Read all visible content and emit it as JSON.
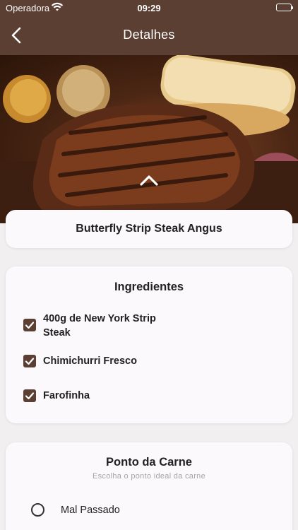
{
  "status_bar": {
    "carrier": "Operadora",
    "time": "09:29"
  },
  "nav": {
    "title": "Detalhes",
    "back_icon": "chevron-left-icon"
  },
  "hero": {
    "image_alt": "steak-photo",
    "expand_icon": "chevron-up-icon"
  },
  "dish": {
    "name": "Butterfly Strip Steak Angus"
  },
  "ingredients": {
    "heading": "Ingredientes",
    "items": [
      {
        "label_line1": "400g de New York Strip",
        "label_line2": "Steak",
        "checked": true
      },
      {
        "label_line1": "Chimichurri Fresco",
        "label_line2": "",
        "checked": true
      },
      {
        "label_line1": "Farofinha",
        "label_line2": "",
        "checked": true
      }
    ]
  },
  "doneness": {
    "heading": "Ponto da Carne",
    "subtitle": "Escolha o ponto ideal da carne",
    "options": [
      {
        "label": "Mal Passado",
        "selected": false
      }
    ]
  },
  "colors": {
    "brand": "#5c3f33",
    "background": "#efecec",
    "card": "#fbf9fb"
  }
}
